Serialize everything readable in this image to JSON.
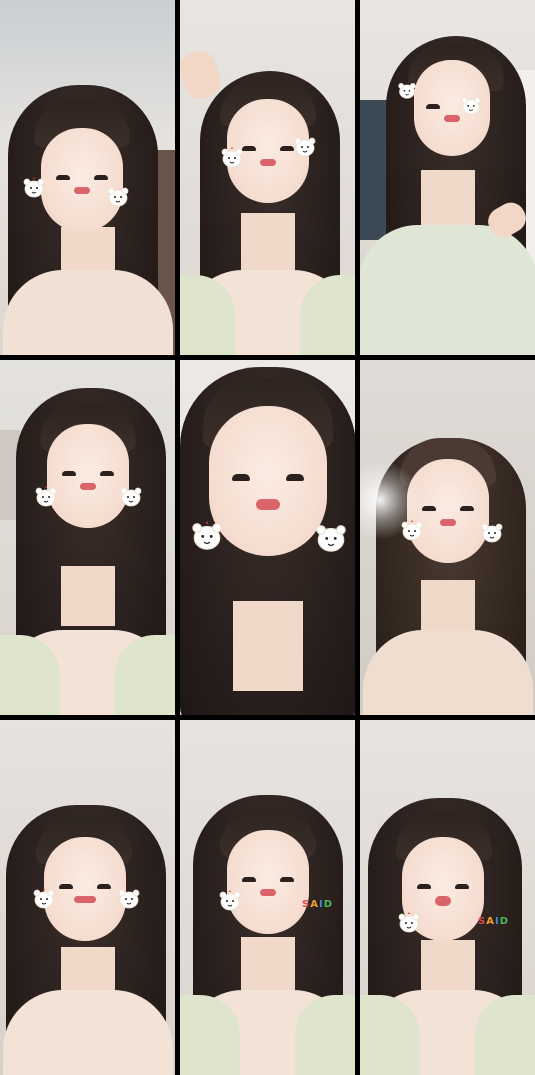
{
  "grid": {
    "columns": 3,
    "rows": 3,
    "background_color": "#000000"
  },
  "cells": [
    {
      "sticker_style": "bear-cheek-stickers",
      "text_overlay": ""
    },
    {
      "sticker_style": "bear-cheek-stickers",
      "text_overlay": ""
    },
    {
      "sticker_style": "bear-cheek-stickers",
      "text_overlay": ""
    },
    {
      "sticker_style": "bear-cheek-stickers",
      "text_overlay": ""
    },
    {
      "sticker_style": "bear-cheek-stickers",
      "text_overlay": ""
    },
    {
      "sticker_style": "bear-cheek-stickers",
      "text_overlay": ""
    },
    {
      "sticker_style": "bear-cheek-stickers",
      "text_overlay": ""
    },
    {
      "sticker_style": "bear-cheek-sticker-with-text",
      "text_overlay": "SAID"
    },
    {
      "sticker_style": "bear-cheek-sticker-with-text",
      "text_overlay": "SAID"
    }
  ],
  "colors": {
    "hair": "#2a201d",
    "skin": "#f5dccf",
    "lips": "#d9646a",
    "cardigan": "#dfe5cc",
    "wall": "#e9e4df"
  },
  "icons": {
    "sticker": "bear-sticker-icon"
  }
}
